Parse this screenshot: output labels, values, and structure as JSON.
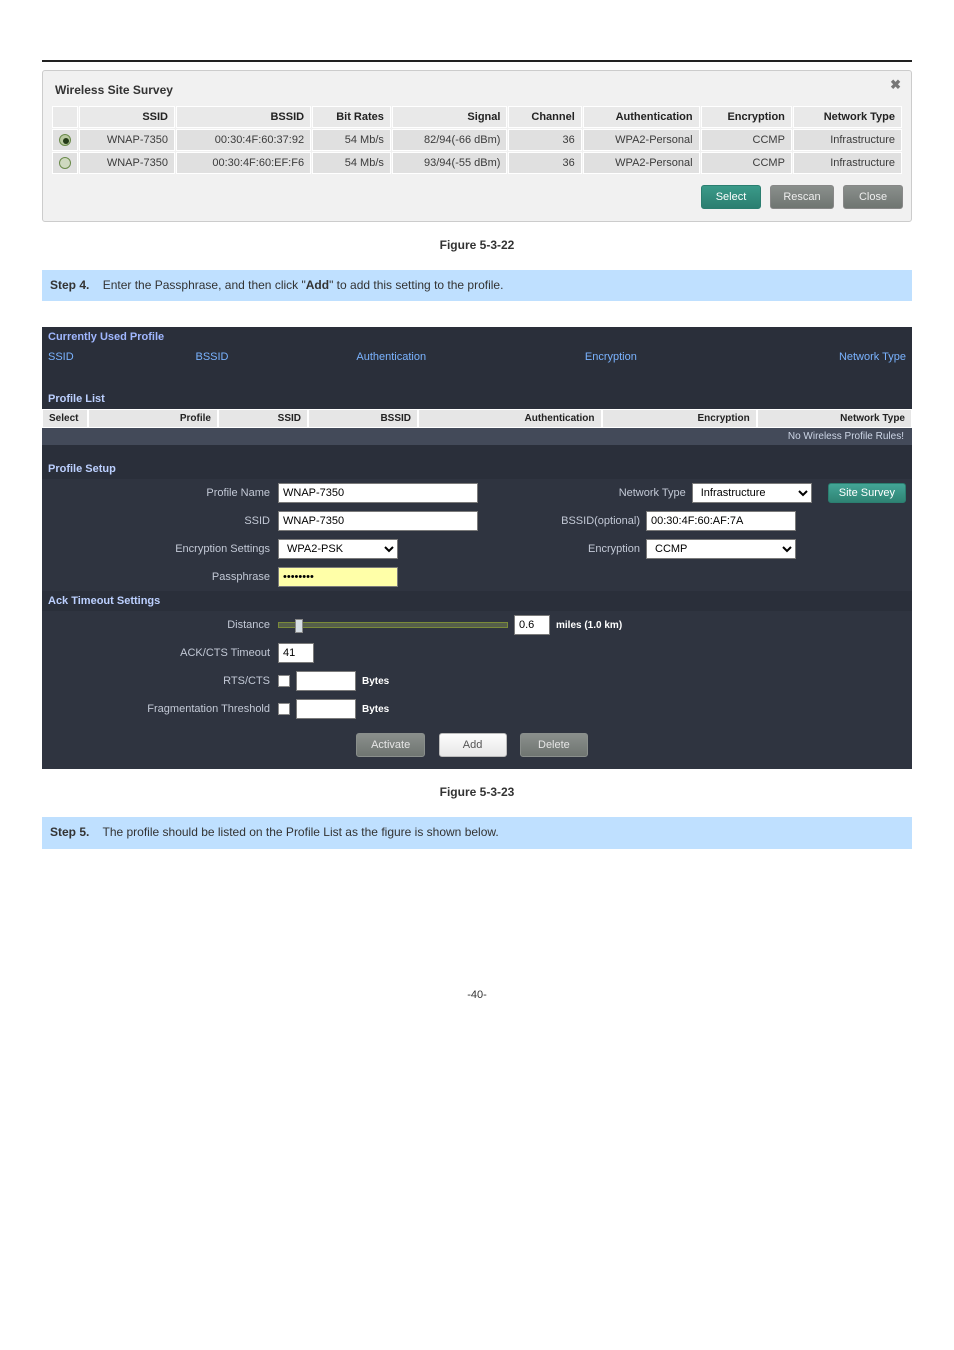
{
  "survey": {
    "panel_title": "Wireless Site Survey",
    "close_glyph": "✖",
    "headers": {
      "ssid": "SSID",
      "bssid": "BSSID",
      "bitrates": "Bit Rates",
      "signal": "Signal",
      "channel": "Channel",
      "auth": "Authentication",
      "enc": "Encryption",
      "ntype": "Network Type"
    },
    "rows": [
      {
        "selected": true,
        "ssid": "WNAP-7350",
        "bssid": "00:30:4F:60:37:92",
        "bitrates": "54 Mb/s",
        "signal": "82/94(-66 dBm)",
        "channel": "36",
        "auth": "WPA2-Personal",
        "enc": "CCMP",
        "ntype": "Infrastructure"
      },
      {
        "selected": false,
        "ssid": "WNAP-7350",
        "bssid": "00:30:4F:60:EF:F6",
        "bitrates": "54 Mb/s",
        "signal": "93/94(-55 dBm)",
        "channel": "36",
        "auth": "WPA2-Personal",
        "enc": "CCMP",
        "ntype": "Infrastructure"
      }
    ],
    "buttons": {
      "select": "Select",
      "rescan": "Rescan",
      "close": "Close"
    }
  },
  "caption1": "Figure 5-3-22",
  "step4": {
    "num": "Step 4.",
    "text_a": "Enter the Passphrase, and then click \"",
    "bold": "Add",
    "text_b": "\" to add this setting to the profile."
  },
  "profile": {
    "currently_used": "Currently Used Profile",
    "hdr": {
      "ssid": "SSID",
      "bssid": "BSSID",
      "auth": "Authentication",
      "enc": "Encryption",
      "ntype": "Network Type"
    },
    "profile_list_title": "Profile List",
    "pl_headers": {
      "select": "Select",
      "profile": "Profile",
      "ssid": "SSID",
      "bssid": "BSSID",
      "auth": "Authentication",
      "enc": "Encryption",
      "ntype": "Network Type"
    },
    "no_rules": "No Wireless Profile Rules!",
    "profile_setup_title": "Profile Setup",
    "labels": {
      "profile_name": "Profile Name",
      "ssid": "SSID",
      "encryption_settings": "Encryption Settings",
      "passphrase": "Passphrase",
      "network_type": "Network Type",
      "bssid_optional": "BSSID(optional)",
      "encryption": "Encryption",
      "site_survey": "Site Survey"
    },
    "values": {
      "profile_name": "WNAP-7350",
      "ssid": "WNAP-7350",
      "encryption_settings": "WPA2-PSK",
      "passphrase": "••••••••",
      "network_type": "Infrastructure",
      "bssid_optional": "00:30:4F:60:AF:7A",
      "encryption": "CCMP"
    },
    "ack_title": "Ack Timeout Settings",
    "ack": {
      "distance_label": "Distance",
      "distance_value": "0.6",
      "distance_unit": "miles (1.0 km)",
      "ackcts_label": "ACK/CTS Timeout",
      "ackcts_value": "41",
      "rtscts_label": "RTS/CTS",
      "frag_label": "Fragmentation Threshold",
      "bytes": "Bytes"
    },
    "buttons": {
      "activate": "Activate",
      "add": "Add",
      "delete": "Delete"
    }
  },
  "caption2": "Figure 5-3-23",
  "step5": {
    "num": "Step 5.",
    "text": "The profile should be listed on the Profile List as the figure is shown below."
  },
  "page_no": "-40-"
}
